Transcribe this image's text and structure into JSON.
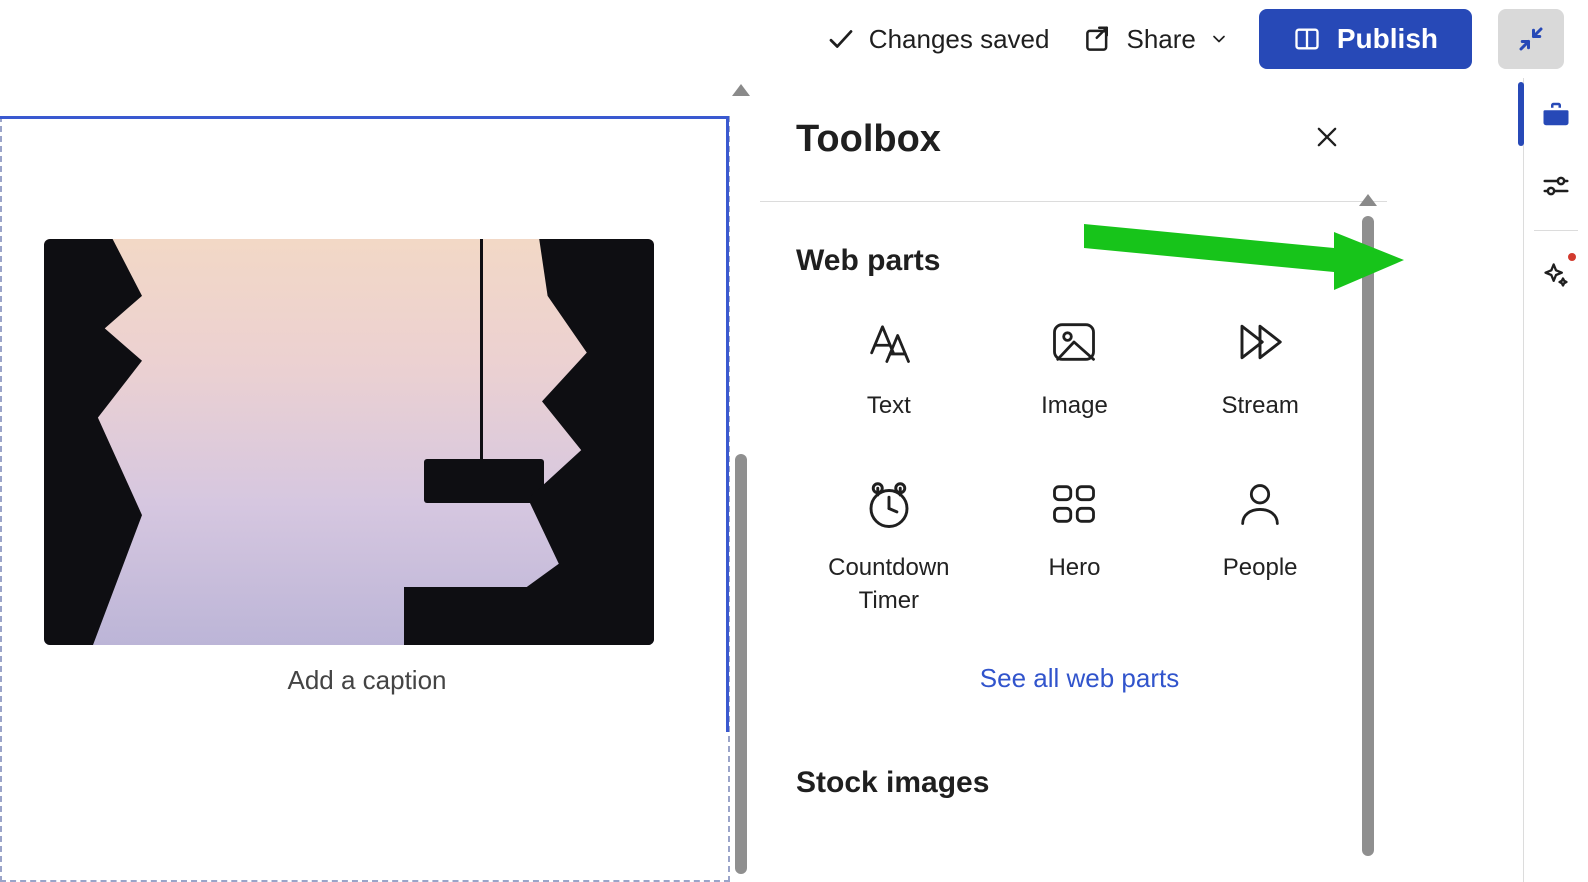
{
  "commandBar": {
    "statusLabel": "Changes saved",
    "shareLabel": "Share",
    "publishLabel": "Publish"
  },
  "canvas": {
    "captionPlaceholder": "Add a caption"
  },
  "toolbox": {
    "title": "Toolbox",
    "webPartsHeading": "Web parts",
    "seeAllLabel": "See all web parts",
    "stockImagesHeading": "Stock images",
    "items": [
      {
        "icon": "text-icon",
        "label": "Text"
      },
      {
        "icon": "image-icon",
        "label": "Image"
      },
      {
        "icon": "stream-icon",
        "label": "Stream"
      },
      {
        "icon": "countdown-timer-icon",
        "label": "Countdown Timer"
      },
      {
        "icon": "hero-icon",
        "label": "Hero"
      },
      {
        "icon": "people-icon",
        "label": "People"
      }
    ]
  },
  "rail": {
    "activeIndex": 0
  }
}
